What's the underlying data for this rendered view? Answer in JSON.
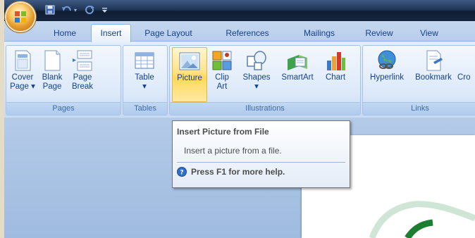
{
  "tabs": [
    {
      "label": "Home",
      "active": false
    },
    {
      "label": "Insert",
      "active": true
    },
    {
      "label": "Page Layout",
      "active": false
    },
    {
      "label": "References",
      "active": false
    },
    {
      "label": "Mailings",
      "active": false
    },
    {
      "label": "Review",
      "active": false
    },
    {
      "label": "View",
      "active": false
    }
  ],
  "groups": {
    "pages": {
      "label": "Pages",
      "buttons": [
        {
          "label": "Cover\nPage ▾",
          "icon": "cover-page-icon"
        },
        {
          "label": "Blank\nPage",
          "icon": "blank-page-icon"
        },
        {
          "label": "Page\nBreak",
          "icon": "page-break-icon"
        }
      ]
    },
    "tables": {
      "label": "Tables",
      "buttons": [
        {
          "label": "Table\n▾",
          "icon": "table-icon"
        }
      ]
    },
    "illustrations": {
      "label": "Illustrations",
      "buttons": [
        {
          "label": "Picture",
          "icon": "picture-icon",
          "highlighted": true
        },
        {
          "label": "Clip\nArt",
          "icon": "clip-art-icon"
        },
        {
          "label": "Shapes\n▾",
          "icon": "shapes-icon"
        },
        {
          "label": "SmartArt",
          "icon": "smartart-icon"
        },
        {
          "label": "Chart",
          "icon": "chart-icon"
        }
      ]
    },
    "links": {
      "label": "Links",
      "buttons": [
        {
          "label": "Hyperlink",
          "icon": "hyperlink-icon"
        },
        {
          "label": "Bookmark",
          "icon": "bookmark-icon"
        },
        {
          "label": "Cro",
          "icon": "cross-reference-icon"
        }
      ]
    }
  },
  "tooltip": {
    "title": "Insert Picture from File",
    "description": "Insert a picture from a file.",
    "help": "Press F1 for more help."
  },
  "colors": {
    "ribbon_text": "#15428b",
    "group_label": "#3e6aaa",
    "highlight": "#ffd85a",
    "titlebar": "#1f3556"
  }
}
